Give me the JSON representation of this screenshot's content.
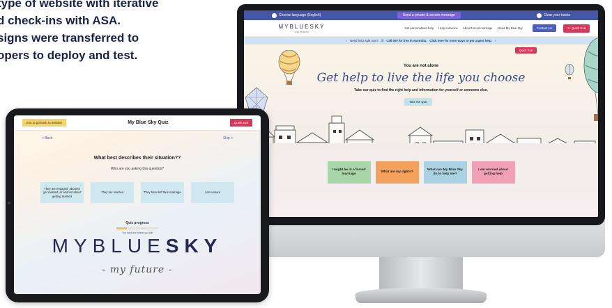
{
  "intro": {
    "lines": [
      "type of website with iterative",
      "d check-ins with ASA.",
      "signs were transferred to",
      "opers to deploy and test."
    ]
  },
  "monitor": {
    "top_bar": {
      "language": "Choose language (English)",
      "message_button": "Send a private & secure message",
      "exit_label": "Clear your tracks"
    },
    "nav": {
      "logo": "MYBLUESKY",
      "logo_tag": "- my future -",
      "links": [
        "Get personalised help",
        "Help someone",
        "About forced marriage",
        "About My Blue Sky"
      ],
      "contact": "Contact Us",
      "quick_exit": "Quick Exit"
    },
    "help_strip": {
      "text": "Need help right now?",
      "phone": "Call 000 for free in Australia.",
      "link": "Click here for more ways to get urgent help."
    },
    "hero": {
      "quick_exit": "Quick Exit",
      "eyebrow": "You are not alone",
      "headline": "Get help to live the life you choose",
      "subhead": "Take our quiz to find the right help and information for yourself or someone else.",
      "quiz_button": "Take the Quiz"
    },
    "cards": [
      {
        "label": "I might be in a forced marriage",
        "color": "#a9d6a8"
      },
      {
        "label": "What are my rights?",
        "color": "#f2a25c"
      },
      {
        "label": "What can My Blue Sky do to help me?",
        "color": "#a9d3e3"
      },
      {
        "label": "I am worried about getting help",
        "color": "#f2a0b5"
      }
    ]
  },
  "tablet": {
    "back_button": "Exit to go back to website",
    "title": "My Blue Sky Quiz",
    "quick_exit": "Quick Exit",
    "nav_back": "< Back",
    "nav_skip": "Skip >",
    "question": "What best describes their situation??",
    "question_sub": "Who are you asking this question?",
    "options": [
      "They are engaged, about to get married, or worried about getting married",
      "They are married",
      "They have left their marriage",
      "I am unsure"
    ],
    "progress_label": "Quiz progress",
    "progress_value": 0.25,
    "progress_text": "You have the further you will",
    "brand_light": "MYBLUE",
    "brand_bold": "SKY",
    "tagline": "- my future -"
  }
}
